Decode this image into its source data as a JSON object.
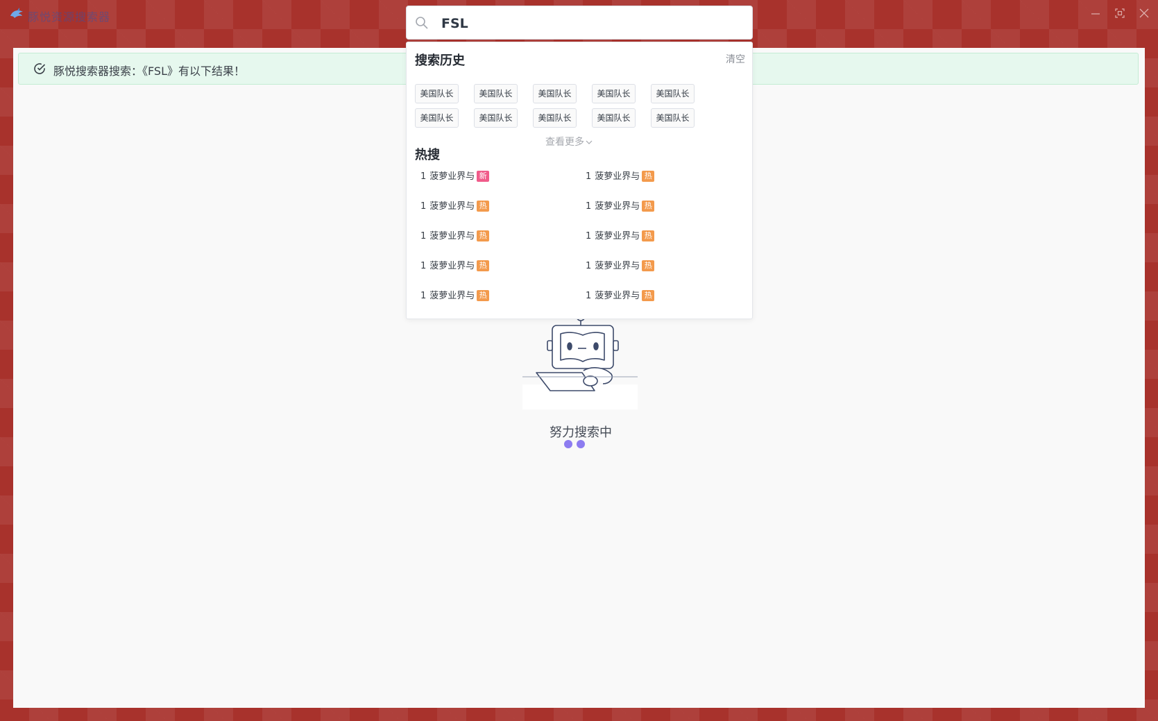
{
  "window": {
    "title": "豚悦资源搜索器",
    "logo_icon": "dolphin-icon",
    "controls": [
      "minimize-icon",
      "fullscreen-icon",
      "close-icon"
    ]
  },
  "search": {
    "value": "FSL",
    "icon": "search-icon"
  },
  "alert": {
    "text": "豚悦搜索器搜索：《FSL》有以下结果！",
    "icon": "check-circle-icon",
    "color": "#e6f8ee"
  },
  "dropdown": {
    "history_title": "搜索历史",
    "clear_label": "清空",
    "history": [
      "美国队长",
      "美国队长",
      "美国队长",
      "美国队长",
      "美国队长",
      "美国队长",
      "美国队长",
      "美国队长",
      "美国队长",
      "美国队长"
    ],
    "more_label": "查看更多",
    "hot_title": "热搜",
    "hot_items": [
      {
        "rank": "1",
        "text": "菠萝业界与",
        "badge": "新",
        "badge_color": "#f05b8a"
      },
      {
        "rank": "1",
        "text": "菠萝业界与",
        "badge": "热",
        "badge_color": "#f39a4c"
      },
      {
        "rank": "1",
        "text": "菠萝业界与",
        "badge": "热",
        "badge_color": "#f39a4c"
      },
      {
        "rank": "1",
        "text": "菠萝业界与",
        "badge": "热",
        "badge_color": "#f39a4c"
      },
      {
        "rank": "1",
        "text": "菠萝业界与",
        "badge": "热",
        "badge_color": "#f39a4c"
      },
      {
        "rank": "1",
        "text": "菠萝业界与",
        "badge": "热",
        "badge_color": "#f39a4c"
      },
      {
        "rank": "1",
        "text": "菠萝业界与",
        "badge": "热",
        "badge_color": "#f39a4c"
      },
      {
        "rank": "1",
        "text": "菠萝业界与",
        "badge": "热",
        "badge_color": "#f39a4c"
      },
      {
        "rank": "1",
        "text": "菠萝业界与",
        "badge": "热",
        "badge_color": "#f39a4c"
      },
      {
        "rank": "1",
        "text": "菠萝业界与",
        "badge": "热",
        "badge_color": "#f39a4c"
      }
    ]
  },
  "loading": {
    "text": "努力搜索中",
    "illustration": "robot-laptop-illustration",
    "dot_color": "#8d7cf0"
  },
  "colors": {
    "window_bg": "#a8322c",
    "content_bg": "#f9f9f9"
  }
}
